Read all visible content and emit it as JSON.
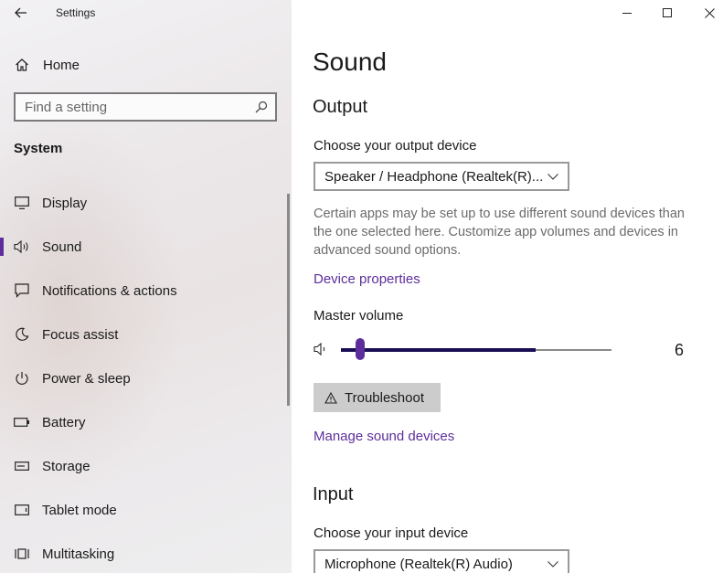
{
  "window": {
    "title": "Settings",
    "controls": {
      "minimize": "minimize-icon",
      "maximize": "maximize-icon",
      "close": "close-icon"
    }
  },
  "sidebar": {
    "home_label": "Home",
    "search_placeholder": "Find a setting",
    "section_title": "System",
    "items": [
      {
        "label": "Display",
        "icon": "display-icon"
      },
      {
        "label": "Sound",
        "icon": "speaker-icon",
        "active": true
      },
      {
        "label": "Notifications & actions",
        "icon": "notification-icon"
      },
      {
        "label": "Focus assist",
        "icon": "moon-icon"
      },
      {
        "label": "Power & sleep",
        "icon": "power-icon"
      },
      {
        "label": "Battery",
        "icon": "battery-icon"
      },
      {
        "label": "Storage",
        "icon": "storage-icon"
      },
      {
        "label": "Tablet mode",
        "icon": "tablet-icon"
      },
      {
        "label": "Multitasking",
        "icon": "multitasking-icon"
      }
    ]
  },
  "main": {
    "title": "Sound",
    "output": {
      "heading": "Output",
      "device_label": "Choose your output device",
      "device_value": "Speaker / Headphone (Realtek(R)...",
      "description": "Certain apps may be set up to use different sound devices than the one selected here. Customize app volumes and devices in advanced sound options.",
      "device_properties_link": "Device properties",
      "master_volume_label": "Master volume",
      "volume_value": "6",
      "volume_fraction": 0.06,
      "troubleshoot_label": "Troubleshoot",
      "manage_link": "Manage sound devices"
    },
    "input": {
      "heading": "Input",
      "device_label": "Choose your input device",
      "device_value": "Microphone (Realtek(R) Audio)"
    }
  },
  "colors": {
    "accent": "#5d2e9b",
    "slider_fill": "#190e54",
    "button_bg": "#cccccc"
  }
}
